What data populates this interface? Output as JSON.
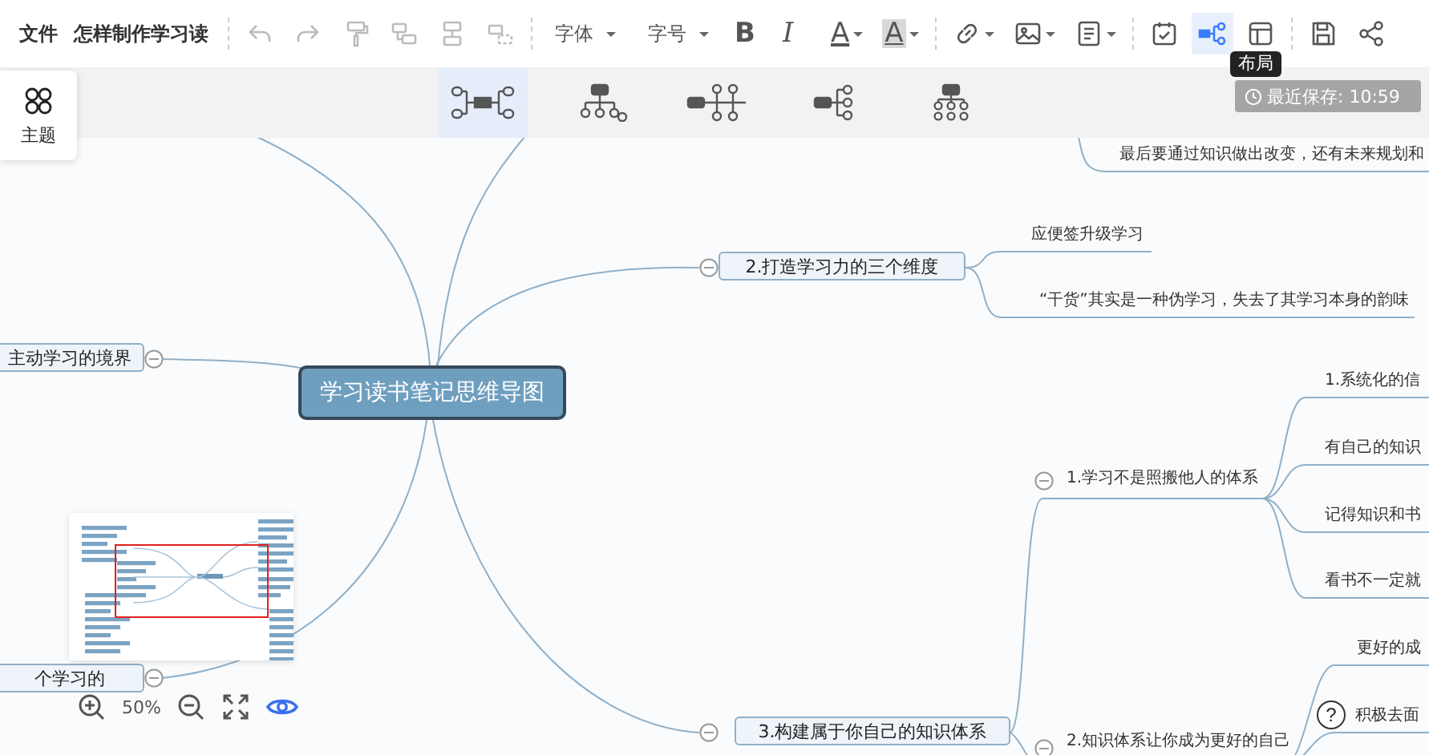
{
  "toolbar": {
    "file_menu": "文件",
    "document_title": "怎样制作学习读",
    "groups": [
      [
        {
          "kind": "undo",
          "disabled": true
        },
        {
          "kind": "redo",
          "disabled": true
        },
        {
          "kind": "format-painter",
          "disabled": true
        },
        {
          "kind": "add-child",
          "disabled": true
        },
        {
          "kind": "add-sibling",
          "disabled": true
        },
        {
          "kind": "add-parent",
          "disabled": true
        }
      ],
      [
        {
          "kind": "dropdown",
          "label": "字体",
          "menu": true
        },
        {
          "kind": "dropdown",
          "label": "字号",
          "menu": true
        },
        {
          "kind": "bold",
          "glyph": "B"
        },
        {
          "kind": "italic",
          "glyph": "I"
        },
        {
          "kind": "font-color",
          "glyph": "A",
          "menu": true
        },
        {
          "kind": "highlight",
          "glyph": "A",
          "menu": true
        }
      ],
      [
        {
          "kind": "link",
          "menu": true
        },
        {
          "kind": "image",
          "menu": true
        },
        {
          "kind": "note",
          "menu": true
        }
      ],
      [
        {
          "kind": "task",
          "selected": false
        },
        {
          "kind": "layout",
          "selected": true
        },
        {
          "kind": "structure",
          "selected": false
        }
      ],
      [
        {
          "kind": "save"
        },
        {
          "kind": "share"
        }
      ]
    ]
  },
  "tooltip": "布局",
  "layout_options": [
    {
      "kind": "mindmap",
      "selected": true
    },
    {
      "kind": "org-down",
      "selected": false
    },
    {
      "kind": "timeline",
      "selected": false
    },
    {
      "kind": "tree-right",
      "selected": false
    },
    {
      "kind": "org-chart",
      "selected": false
    }
  ],
  "save_status": "最近保存: 10:59",
  "theme_button": "主题",
  "mind_map": {
    "root": "学习读书笔记思维导图",
    "detached_leaves": [
      "最后要通过知识做出改变，还有未来规划和"
    ],
    "branches": [
      {
        "text": "主动学习的境界",
        "expanded": true
      },
      {
        "text": "个学习的",
        "expanded": true
      },
      {
        "text": "2.打造学习力的三个维度",
        "expanded": true,
        "children": [
          {
            "text": "应便签升级学习"
          },
          {
            "text": "“干货”其实是一种伪学习，失去了其学习本身的韵味"
          }
        ]
      },
      {
        "text": "3.构建属于你自己的知识体系",
        "expanded": true,
        "children": [
          {
            "text": "1.学习不是照搬他人的体系",
            "expanded": true,
            "children": [
              {
                "text": "1.系统化的信"
              },
              {
                "text": "有自己的知识"
              },
              {
                "text": "记得知识和书"
              },
              {
                "text": "看书不一定就"
              }
            ]
          },
          {
            "text": "2.知识体系让你成为更好的自己",
            "expanded": true,
            "children": [
              {
                "text": "更好的成"
              },
              {
                "text": "积极去面"
              }
            ]
          }
        ]
      }
    ]
  },
  "zoom": {
    "level_text": "50%"
  },
  "minimap_visible": true,
  "help_button": "?"
}
